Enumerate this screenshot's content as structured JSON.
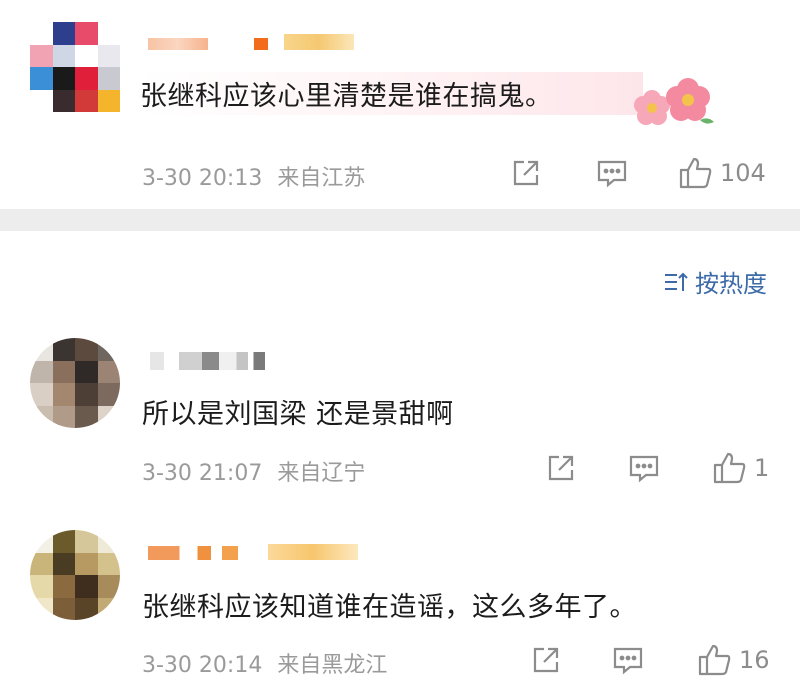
{
  "comments": [
    {
      "text": "张继科应该心里清楚是谁在搞鬼。",
      "time": "3-30 20:13",
      "location": "来自江苏",
      "likes": "104",
      "share_icon": "share-icon",
      "reply_icon": "reply-icon",
      "like_icon": "thumbs-up-icon"
    },
    {
      "text": "所以是刘国梁 还是景甜啊",
      "time": "3-30 21:07",
      "location": "来自辽宁",
      "likes": "1",
      "share_icon": "share-icon",
      "reply_icon": "reply-icon",
      "like_icon": "thumbs-up-icon"
    },
    {
      "text": "张继科应该知道谁在造谣，这么多年了。",
      "time": "3-30 20:14",
      "location": "来自黑龙江",
      "likes": "16",
      "share_icon": "share-icon",
      "reply_icon": "reply-icon",
      "like_icon": "thumbs-up-icon"
    }
  ],
  "sort": {
    "label": "按热度",
    "icon": "sort-icon"
  },
  "colors": {
    "link": "#3c6ba8",
    "meta": "#9a9a9a",
    "separator": "#ededed",
    "name_orange": "#f5a25d"
  }
}
